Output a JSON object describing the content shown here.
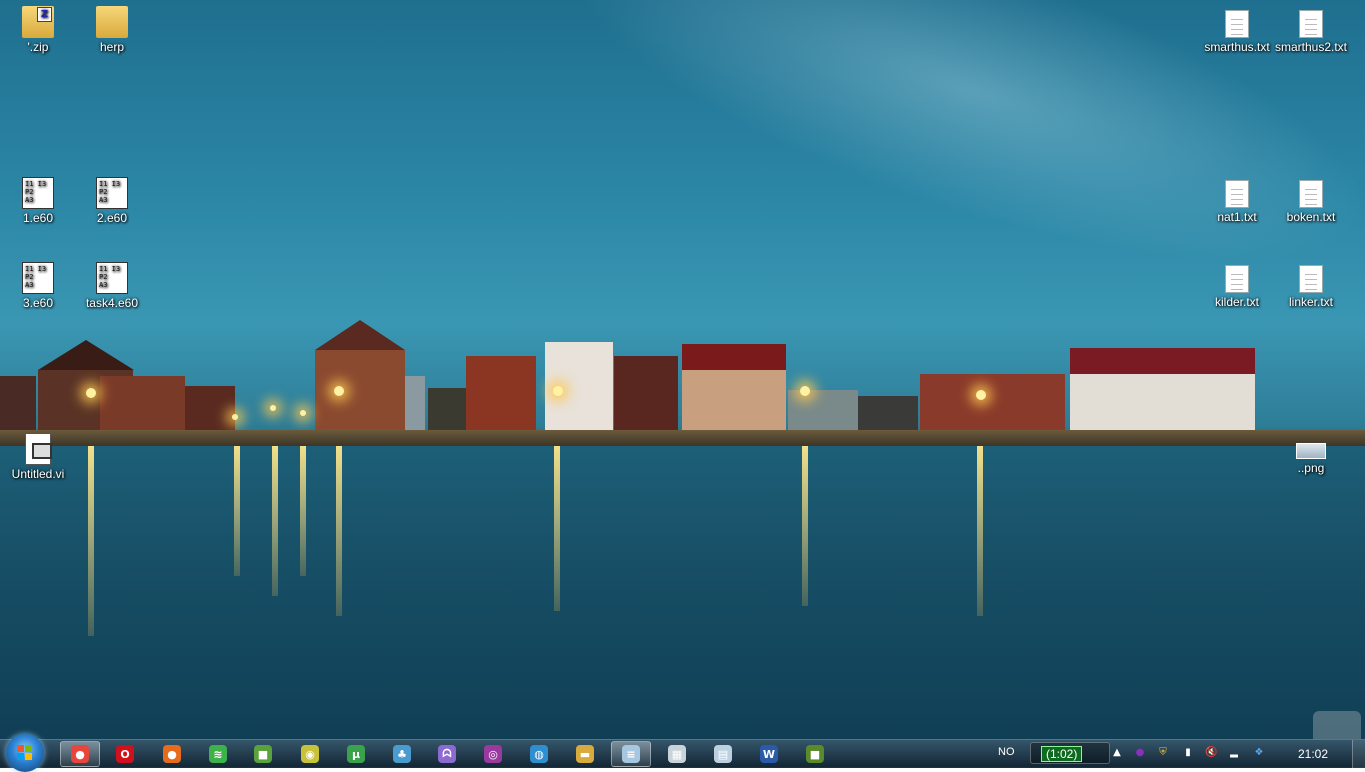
{
  "desktop_icons": [
    {
      "id": "zip",
      "label": "'.zip",
      "type": "zip"
    },
    {
      "id": "herp",
      "label": "herp",
      "type": "folder"
    },
    {
      "id": "smarthus",
      "label": "smarthus.txt",
      "type": "txt"
    },
    {
      "id": "smarthus2",
      "label": "smarthus2.txt",
      "type": "txt"
    },
    {
      "id": "e60-1",
      "label": "1.e60",
      "type": "e60"
    },
    {
      "id": "e60-2",
      "label": "2.e60",
      "type": "e60"
    },
    {
      "id": "nat1",
      "label": "nat1.txt",
      "type": "txt"
    },
    {
      "id": "boken",
      "label": "boken.txt",
      "type": "txt"
    },
    {
      "id": "e60-3",
      "label": "3.e60",
      "type": "e60"
    },
    {
      "id": "task4",
      "label": "task4.e60",
      "type": "e60"
    },
    {
      "id": "kilder",
      "label": "kilder.txt",
      "type": "txt"
    },
    {
      "id": "linker",
      "label": "linker.txt",
      "type": "txt"
    },
    {
      "id": "untitled-vi",
      "label": "Untitled.vi",
      "type": "vi"
    },
    {
      "id": "png",
      "label": "..png",
      "type": "png"
    }
  ],
  "e60_glyph": "I1 I3\nP2\nA3",
  "zip_badge": "Z",
  "taskbar": {
    "pinned": [
      {
        "name": "chrome",
        "icon": "chrome-icon",
        "color": "#e8453c",
        "glyph": "●",
        "active": true
      },
      {
        "name": "opera",
        "icon": "opera-icon",
        "color": "#d0101a",
        "glyph": "O"
      },
      {
        "name": "firefox",
        "icon": "firefox-icon",
        "color": "#e66b1c",
        "glyph": "●"
      },
      {
        "name": "spotify",
        "icon": "spotify-icon",
        "color": "#3fb14a",
        "glyph": "≋"
      },
      {
        "name": "minecraft-launcher",
        "icon": "game-icon",
        "color": "#5aa23c",
        "glyph": "■"
      },
      {
        "name": "pidgin",
        "icon": "eye-icon",
        "color": "#c8c23a",
        "glyph": "◉"
      },
      {
        "name": "utorrent",
        "icon": "utorrent-icon",
        "color": "#3aa24a",
        "glyph": "µ"
      },
      {
        "name": "network-app",
        "icon": "people-icon",
        "color": "#4a9bd0",
        "glyph": "♣"
      },
      {
        "name": "pacman-app",
        "icon": "ghost-icon",
        "color": "#8e6ad0",
        "glyph": "ᗣ"
      },
      {
        "name": "media-app",
        "icon": "disc-icon",
        "color": "#9a3aa0",
        "glyph": "◎"
      },
      {
        "name": "globe-app",
        "icon": "globe-icon",
        "color": "#2f8ed0",
        "glyph": "◍"
      },
      {
        "name": "explorer",
        "icon": "folder-icon",
        "color": "#d9aa3c",
        "glyph": "▬"
      },
      {
        "name": "notepad",
        "icon": "notepad-icon",
        "color": "#a7c7e0",
        "glyph": "≡",
        "active": true
      },
      {
        "name": "calculator",
        "icon": "calculator-icon",
        "color": "#c9d3da",
        "glyph": "▦"
      },
      {
        "name": "document-viewer",
        "icon": "document-icon",
        "color": "#bcd0e0",
        "glyph": "▤"
      },
      {
        "name": "word",
        "icon": "word-icon",
        "color": "#2b5aa8",
        "glyph": "W"
      },
      {
        "name": "minecraft",
        "icon": "grass-block-icon",
        "color": "#5a8a2c",
        "glyph": "■"
      }
    ],
    "language": "NO",
    "battery_time": "(1:02)",
    "clock": "21:02",
    "tray": [
      {
        "name": "show-hidden",
        "icon": "up-arrow-icon",
        "glyph": "▲"
      },
      {
        "name": "onenote",
        "icon": "onenote-icon",
        "glyph": "●",
        "color": "#8a2fc0"
      },
      {
        "name": "security",
        "icon": "shield-icon",
        "glyph": "⛨",
        "color": "#f0c030"
      },
      {
        "name": "power",
        "icon": "battery-icon",
        "glyph": "▮"
      },
      {
        "name": "volume",
        "icon": "speaker-muted-icon",
        "glyph": "🔇"
      },
      {
        "name": "network",
        "icon": "signal-icon",
        "glyph": "▂"
      },
      {
        "name": "dropbox",
        "icon": "dropbox-icon",
        "glyph": "❖",
        "color": "#5aa8f0"
      }
    ]
  }
}
